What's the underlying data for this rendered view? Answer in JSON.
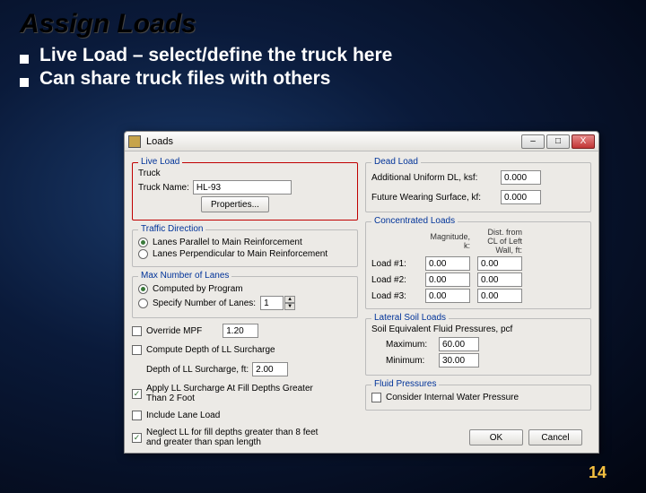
{
  "slide": {
    "title": "Assign Loads",
    "bullets": [
      "Live Load – select/define the truck here",
      "Can share truck files with others"
    ],
    "pageNumber": "14"
  },
  "window": {
    "title": "Loads",
    "buttons": {
      "min": "–",
      "max": "□",
      "close": "X"
    }
  },
  "left": {
    "liveLoad": {
      "legend": "Live Load",
      "truckLabel": "Truck",
      "nameLabel": "Truck Name:",
      "nameValue": "HL-93",
      "propertiesBtn": "Properties..."
    },
    "traffic": {
      "legend": "Traffic Direction",
      "opt1": "Lanes Parallel to Main Reinforcement",
      "opt2": "Lanes Perpendicular to Main Reinforcement"
    },
    "lanes": {
      "legend": "Max Number of Lanes",
      "opt1": "Computed by Program",
      "opt2": "Specify Number of Lanes:",
      "value": "1"
    },
    "misc": {
      "overrideMPF": "Override MPF",
      "mpfValue": "1.20",
      "computeDepth": "Compute Depth of LL Surcharge",
      "depthLabel": "Depth of LL Surcharge, ft:",
      "depthValue": "2.00",
      "applySurcharge": "Apply LL Surcharge At Fill Depths Greater Than 2 Foot",
      "includeLane": "Include Lane Load",
      "neglect": "Neglect LL for fill depths greater than 8 feet and greater than span length"
    }
  },
  "right": {
    "deadLoad": {
      "legend": "Dead Load",
      "addlLabel": "Additional Uniform DL, ksf:",
      "addlValue": "0.000",
      "fwsLabel": "Future Wearing Surface, kf:",
      "fwsValue": "0.000"
    },
    "conc": {
      "legend": "Concentrated Loads",
      "hdrMag": "Magnitude, k:",
      "hdrDist": "Dist. from CL of Left Wall, ft:",
      "rows": [
        {
          "label": "Load #1:",
          "mag": "0.00",
          "dist": "0.00"
        },
        {
          "label": "Load #2:",
          "mag": "0.00",
          "dist": "0.00"
        },
        {
          "label": "Load #3:",
          "mag": "0.00",
          "dist": "0.00"
        }
      ]
    },
    "soil": {
      "legend": "Lateral Soil Loads",
      "sub": "Soil Equivalent Fluid Pressures, pcf",
      "maxLabel": "Maximum:",
      "maxValue": "60.00",
      "minLabel": "Minimum:",
      "minValue": "30.00"
    },
    "fluid": {
      "legend": "Fluid Pressures",
      "consider": "Consider Internal Water Pressure"
    }
  },
  "footerButtons": {
    "ok": "OK",
    "cancel": "Cancel"
  }
}
